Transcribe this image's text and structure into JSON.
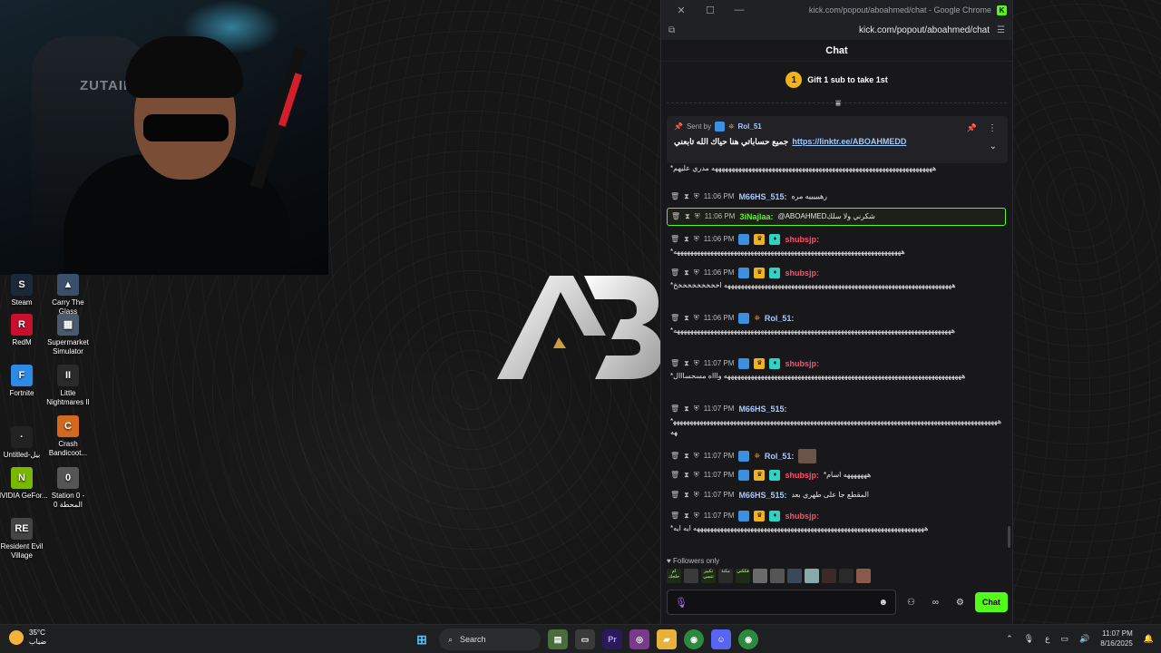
{
  "webcam": {
    "chair_text": "ZUTAIN"
  },
  "desktop_icons": [
    {
      "label": "Steam",
      "icon": "steam-icon",
      "color": "#1b2838"
    },
    {
      "label": "Carry The Glass",
      "icon": "game-icon",
      "color": "#3a4f6a"
    },
    {
      "label": "RedM",
      "icon": "redm-icon",
      "color": "#c8102e"
    },
    {
      "label": "Supermarket Simulator",
      "icon": "game-icon",
      "color": "#4a5a6a"
    },
    {
      "label": "Fortnite",
      "icon": "fortnite-icon",
      "color": "#2d8be6"
    },
    {
      "label": "Little Nightmares II",
      "icon": "game-icon",
      "color": "#2a2a2a"
    },
    {
      "label": "Untitled-بيل",
      "icon": "file-icon",
      "color": "#222"
    },
    {
      "label": "Crash Bandicoot...",
      "icon": "game-icon",
      "color": "#d2691e"
    },
    {
      "label": "NVIDIA GeFor...",
      "icon": "nvidia-icon",
      "color": "#76b900"
    },
    {
      "label": "Station 0 - المحطة 0",
      "icon": "game-icon",
      "color": "#555"
    },
    {
      "label": "Resident Evil Village",
      "icon": "game-icon",
      "color": "#444"
    }
  ],
  "browser": {
    "title": "kick.com/popout/aboahmed/chat - Google Chrome",
    "url": "kick.com/popout/aboahmed/chat"
  },
  "chat": {
    "header": "Chat",
    "gift_count": "1",
    "gift_text": "Gift 1 sub to take 1st",
    "pinned": {
      "sent_by_label": "Sent by",
      "user": "Rol_51",
      "text": "جميع حساباتي هنا حياك الله تابعني",
      "link": "https://linktr.ee/ABOAHMEDD"
    },
    "messages": [
      {
        "time": "",
        "user": "",
        "text": "*ههههههههههههههههههههههههههههههههههههههههههههههههههههههههههههههههههه مدري عليهم",
        "user_color": "#fff"
      },
      {
        "time": "11:06 PM",
        "user": "M66HS_515:",
        "text": "رهيييييه مره",
        "user_color": "#a8c8ff"
      },
      {
        "time": "11:06 PM",
        "user": "3iNajlaa:",
        "text": "@ABOAHMEDشكرني ولا سلك",
        "user_color": "#53fc18"
      },
      {
        "time": "11:06 PM",
        "user": "shubsjp:",
        "text": "*ههههههههههههههههههههههههههههههههههههههههههههههههههههههههههههههههههههه",
        "user_color": "#ff4d6d"
      },
      {
        "time": "11:06 PM",
        "user": "shubsjp:",
        "text": "*ههههههههههههههههههههههههههههههههههههههههههههههههههههههههههههههههههههه اخخخخخخخخخخ",
        "user_color": "#ff4d6d"
      },
      {
        "time": "11:06 PM",
        "user": "Rol_51:",
        "text": "*هههههههههههههههههههههههههههههههههههههههههههههههههههههههههههههههههههههههههههههههههههه",
        "user_color": "#a8c8ff"
      },
      {
        "time": "11:07 PM",
        "user": "shubsjp:",
        "text": "*هههههههههههههههههههههههههههههههههههههههههههههههههههههههههههههههههههههههه واااه مسحسااال",
        "user_color": "#ff4d6d"
      },
      {
        "time": "11:07 PM",
        "user": "M66HS_515:",
        "text": "*هههههههههههههههههههههههههههههههههههههههههههههههههههههههههههههههههههههههههههههههههههههههههههههههههههه",
        "user_color": "#a8c8ff"
      },
      {
        "time": "11:07 PM",
        "user": "Rol_51:",
        "text": "",
        "user_color": "#a8c8ff"
      },
      {
        "time": "11:07 PM",
        "user": "shubsjp:",
        "text": "*هههههههه اسام",
        "user_color": "#ff4d6d"
      },
      {
        "time": "11:07 PM",
        "user": "M66HS_515:",
        "text": "المقطع جا على طهري بعد",
        "user_color": "#a8c8ff"
      },
      {
        "time": "11:07 PM",
        "user": "shubsjp:",
        "text": "*هههههههههههههههههههههههههههههههههههههههههههههههههههههههههههههههههههههه ايه ايه",
        "user_color": "#ff4d6d"
      }
    ],
    "followers_only": "Followers only",
    "emotes": [
      "ام حلحك",
      "",
      "تكبير تنسي",
      "مكنة",
      "فككني",
      "",
      "",
      "",
      "",
      "",
      "",
      ""
    ],
    "input_placeholder": "",
    "send_label": "Chat"
  },
  "taskbar": {
    "weather_temp": "35°C",
    "weather_desc": "ضباب",
    "search_label": "Search",
    "lang": "ع",
    "time": "11:07 PM",
    "date": "8/16/2025"
  },
  "colors": {
    "kick_green": "#53fc18",
    "accent_gold": "#f2b21b"
  }
}
